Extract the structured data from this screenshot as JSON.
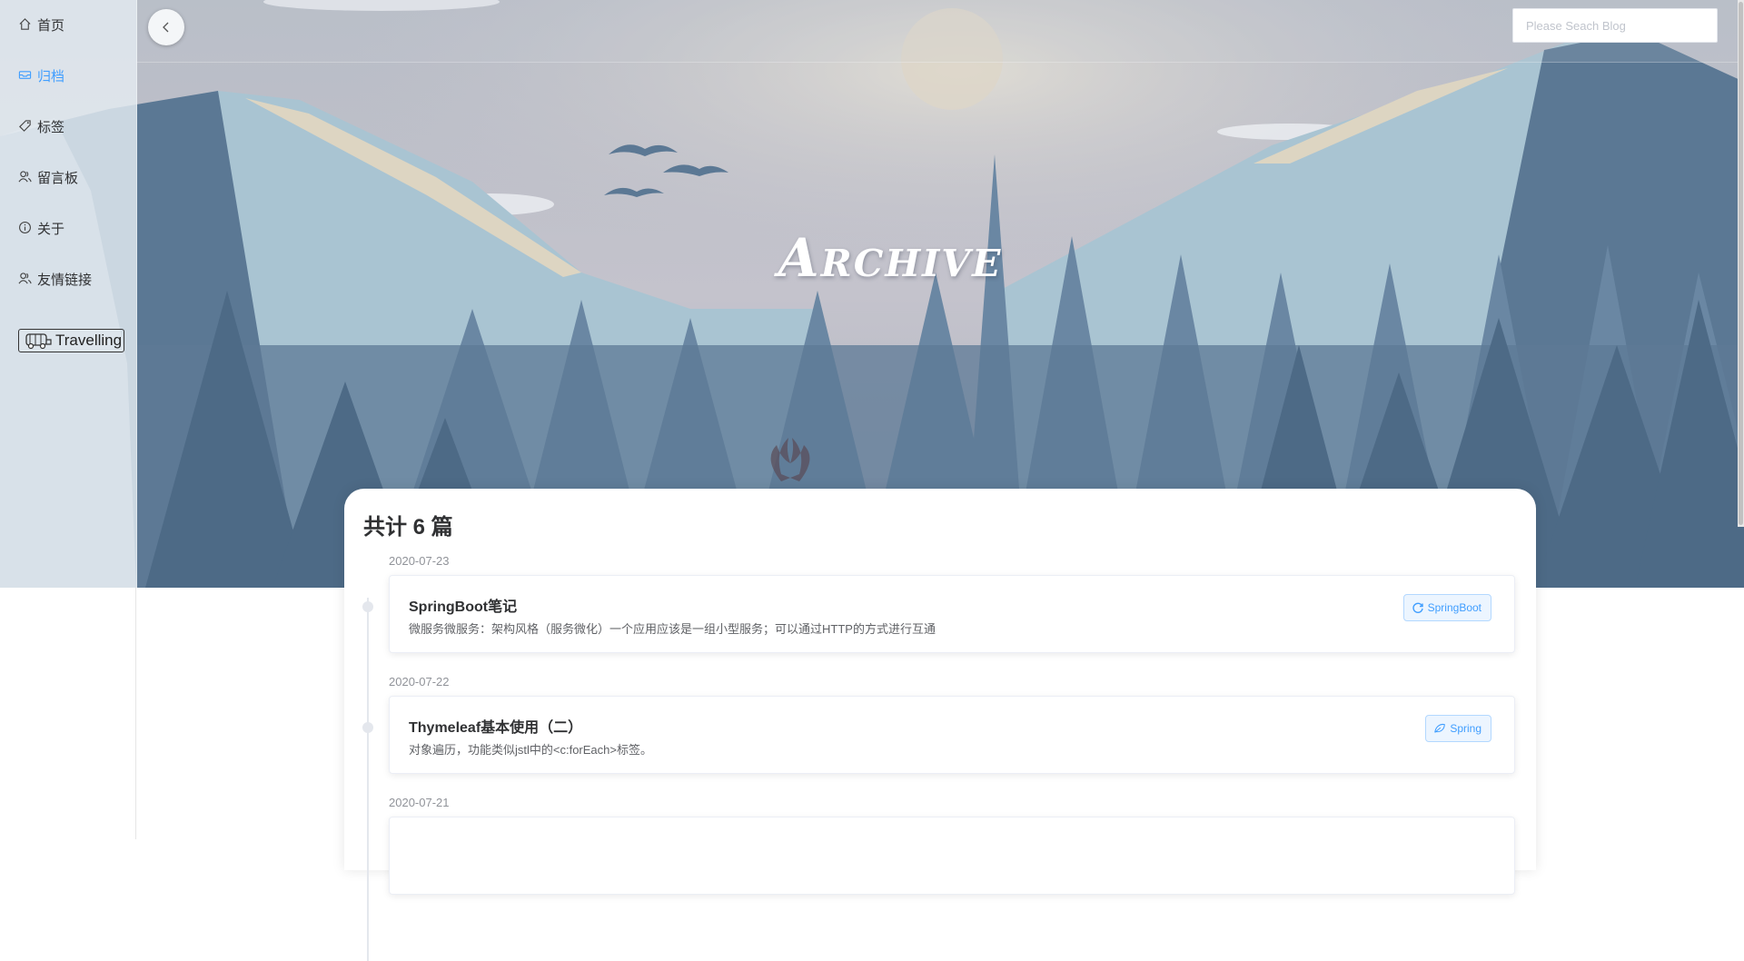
{
  "header": {
    "hero_title": "Archive",
    "search_placeholder": "Please Seach Blog"
  },
  "sidebar": {
    "items": [
      {
        "label": "首页",
        "icon": "home-icon"
      },
      {
        "label": "归档",
        "icon": "archive-box-icon",
        "active": true
      },
      {
        "label": "标签",
        "icon": "tag-icon"
      },
      {
        "label": "留言板",
        "icon": "users-icon"
      },
      {
        "label": "关于",
        "icon": "info-icon"
      },
      {
        "label": "友情链接",
        "icon": "users-icon"
      }
    ],
    "travel_label": "Travelling"
  },
  "archive": {
    "count_title": "共计 6 篇",
    "posts": [
      {
        "date": "2020-07-23",
        "title": "SpringBoot笔记",
        "description": "微服务微服务：架构风格（服务微化）一个应用应该是一组小型服务；可以通过HTTP的方式进行互通",
        "tag": "SpringBoot",
        "tag_icon": "refresh-icon"
      },
      {
        "date": "2020-07-22",
        "title": "Thymeleaf基本使用（二）",
        "description": "对象遍历，功能类似jstl中的<c:forEach>标签。",
        "tag": "Spring",
        "tag_icon": "leaf-icon"
      },
      {
        "date": "2020-07-21"
      }
    ]
  },
  "colors": {
    "accent": "#409eff",
    "text_primary": "#303133",
    "text_secondary": "#606266",
    "date": "#909399"
  }
}
